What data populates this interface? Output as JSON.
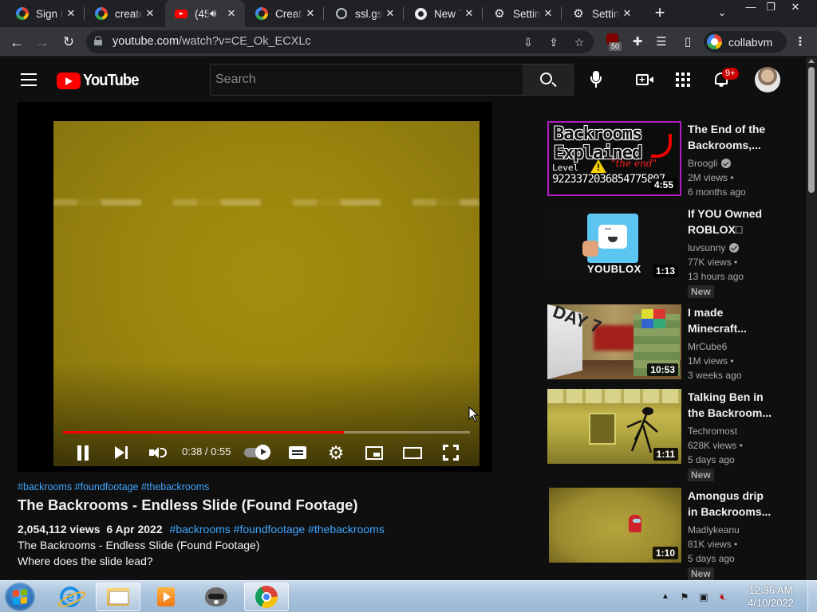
{
  "browser": {
    "tabs": [
      {
        "title": "Sign in",
        "favicon": "google-icon",
        "active": false,
        "audio": false
      },
      {
        "title": "create",
        "favicon": "google-icon",
        "active": false,
        "audio": false
      },
      {
        "title": "(45",
        "favicon": "youtube-icon",
        "active": true,
        "audio": true
      },
      {
        "title": "Create",
        "favicon": "google-icon",
        "active": false,
        "audio": false
      },
      {
        "title": "ssl.gst",
        "favicon": "globe-icon",
        "active": false,
        "audio": false
      },
      {
        "title": "New T",
        "favicon": "chrome-icon",
        "active": false,
        "audio": false
      },
      {
        "title": "Settin",
        "favicon": "gear-icon",
        "active": false,
        "audio": false
      },
      {
        "title": "Settin",
        "favicon": "gear-icon",
        "active": false,
        "audio": false
      }
    ],
    "close_glyph": "✕",
    "new_tab_glyph": "+",
    "tab_search_glyph": "⌄",
    "window_buttons": {
      "minimize": "—",
      "restore": "❐",
      "close": "✕"
    },
    "url_host": "youtube.com",
    "url_path": "/watch?v=CE_Ok_ECXLc",
    "ublock_badge": "50",
    "profile_name": "collabvm"
  },
  "youtube": {
    "logo_text": "YouTube",
    "search_placeholder": "Search",
    "notification_count": "9+",
    "player": {
      "current_time": "0:38",
      "duration": "0:55",
      "time_separator": " / ",
      "progress_fraction": 0.69,
      "autoplay_on": true
    },
    "video": {
      "hashtags_top": "#backrooms #foundfootage #thebackrooms",
      "title": "The Backrooms - Endless Slide (Found Footage)",
      "views": "2,054,112 views",
      "date": "6 Apr 2022",
      "hashtags_inline": "#backrooms #foundfootage #thebackrooms",
      "description_line1": "The Backrooms - Endless Slide (Found Footage)",
      "description_line2": "Where does the slide lead?"
    },
    "recommendations": [
      {
        "title": "The End of the Backrooms,...",
        "channel": "Broogli",
        "verified": true,
        "views": "2M views •",
        "age": "6 months ago",
        "duration": "4:55",
        "is_new": false,
        "thumb_text": {
          "line1": "Backrooms",
          "line2": "Explained",
          "level": "Level",
          "number": "9223372036854775807",
          "end": "\"the end\""
        }
      },
      {
        "title": "If YOU Owned ROBLOX□",
        "channel": "luvsunny",
        "verified": true,
        "views": "77K views •",
        "age": "13 hours ago",
        "duration": "1:13",
        "is_new": true,
        "thumb_text": {
          "logo": "YOUBLOX"
        }
      },
      {
        "title": "I made Minecraft...",
        "channel": "MrCube6",
        "verified": false,
        "views": "1M views •",
        "age": "3 weeks ago",
        "duration": "10:53",
        "is_new": false,
        "thumb_text": {
          "day": "DAY 7"
        }
      },
      {
        "title": "Talking Ben in the Backroom...",
        "channel": "Techromost",
        "verified": false,
        "views": "628K views •",
        "age": "5 days ago",
        "duration": "1:11",
        "is_new": true
      },
      {
        "title": "Amongus drip in Backrooms...",
        "channel": "Madlykeanu",
        "verified": false,
        "views": "81K views •",
        "age": "5 days ago",
        "duration": "1:10",
        "is_new": true
      }
    ],
    "new_label": "New"
  },
  "taskbar": {
    "clock_time": "12:36 AM",
    "clock_date": "4/10/2022",
    "tray_arrow": "▲",
    "apps": [
      "internet-explorer",
      "file-explorer",
      "media-player",
      "raccoon-app",
      "chrome"
    ]
  },
  "colors": {
    "youtube_red": "#ff0000",
    "link_blue": "#3ea6ff",
    "video_yellow": "#9b850d",
    "chrome_dark": "#202124"
  }
}
